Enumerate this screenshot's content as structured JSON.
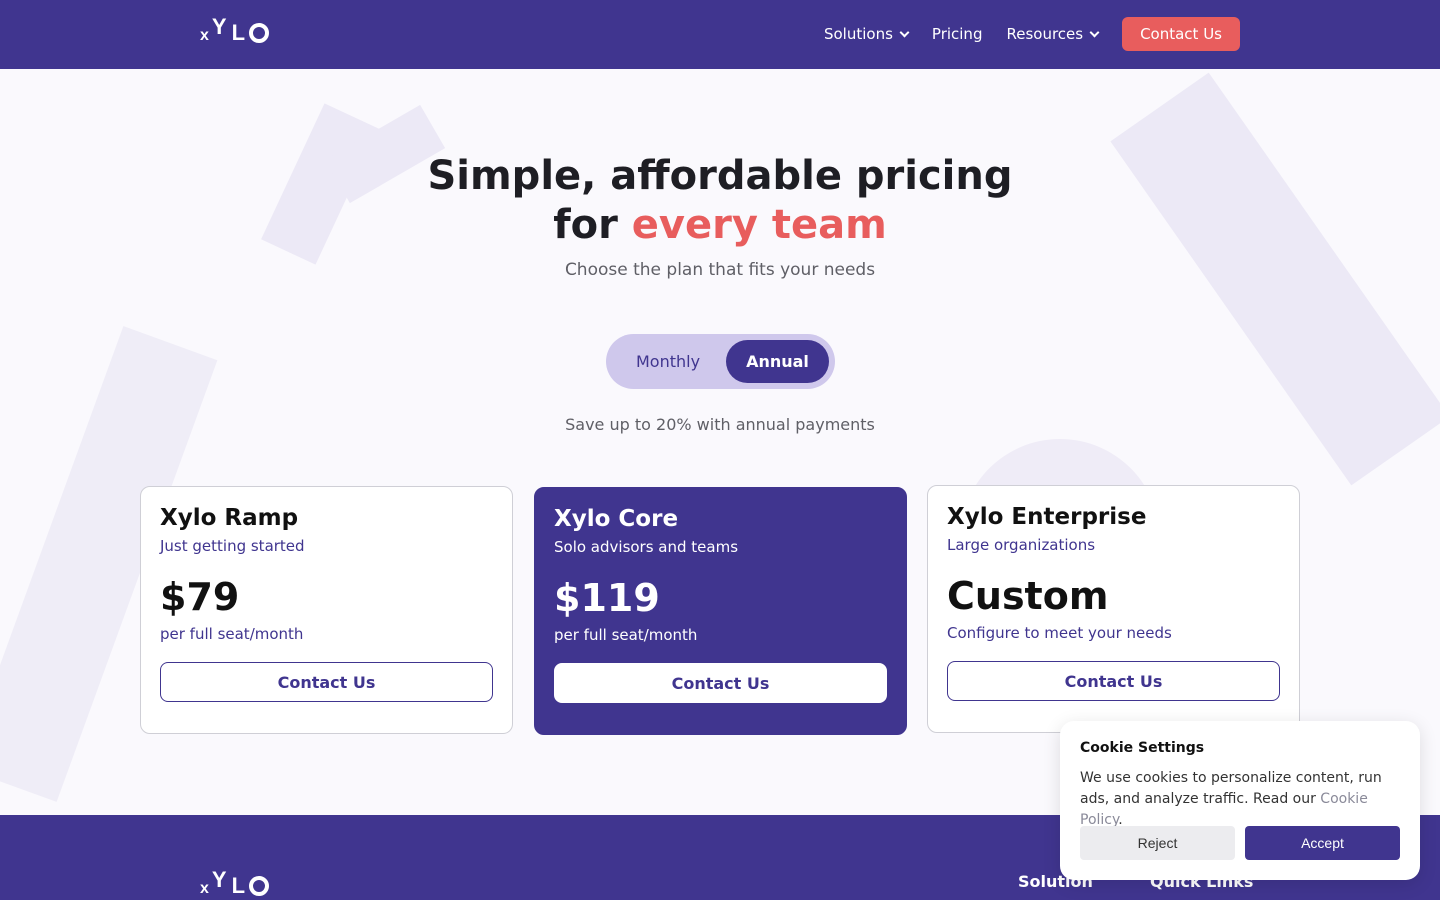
{
  "nav": {
    "logo": {
      "l1": "x",
      "l2": "Y",
      "l3": "L",
      "l4": "O"
    },
    "links": [
      {
        "label": "Solutions"
      },
      {
        "label": "Pricing"
      },
      {
        "label": "Resources"
      }
    ],
    "cta": "Contact Us"
  },
  "hero": {
    "title_line1": "Simple, affordable pricing",
    "title_line2_prefix": "for ",
    "title_line2_accent": "every team",
    "subtitle": "Choose the plan that fits your needs"
  },
  "billing_toggle": {
    "options": [
      "Monthly",
      "Annual"
    ],
    "selected": "Annual",
    "note": "Save up to 20% with annual payments"
  },
  "plans": [
    {
      "name": "Xylo Ramp",
      "tagline": "Just getting started",
      "price": "$79",
      "unit": "per full seat/month",
      "cta": "Contact Us"
    },
    {
      "name": "Xylo Core",
      "tagline": "Solo advisors and teams",
      "price": "$119",
      "unit": "per full seat/month",
      "cta": "Contact Us"
    },
    {
      "name": "Xylo Enterprise",
      "tagline": "Large organizations",
      "price": "Custom",
      "unit": "Configure to meet your needs",
      "cta": "Contact Us"
    }
  ],
  "cookie": {
    "title": "Cookie Settings",
    "text": "We use cookies to personalize content, run ads, and analyze traffic. Read our ",
    "link": "Cookie Policy",
    "text_end": ".",
    "reject": "Reject",
    "accept": "Accept"
  },
  "footer": {
    "columns": [
      "Solution",
      "Quick Links"
    ]
  },
  "colors": {
    "brand": "#40358f",
    "accent": "#e85d5d"
  }
}
